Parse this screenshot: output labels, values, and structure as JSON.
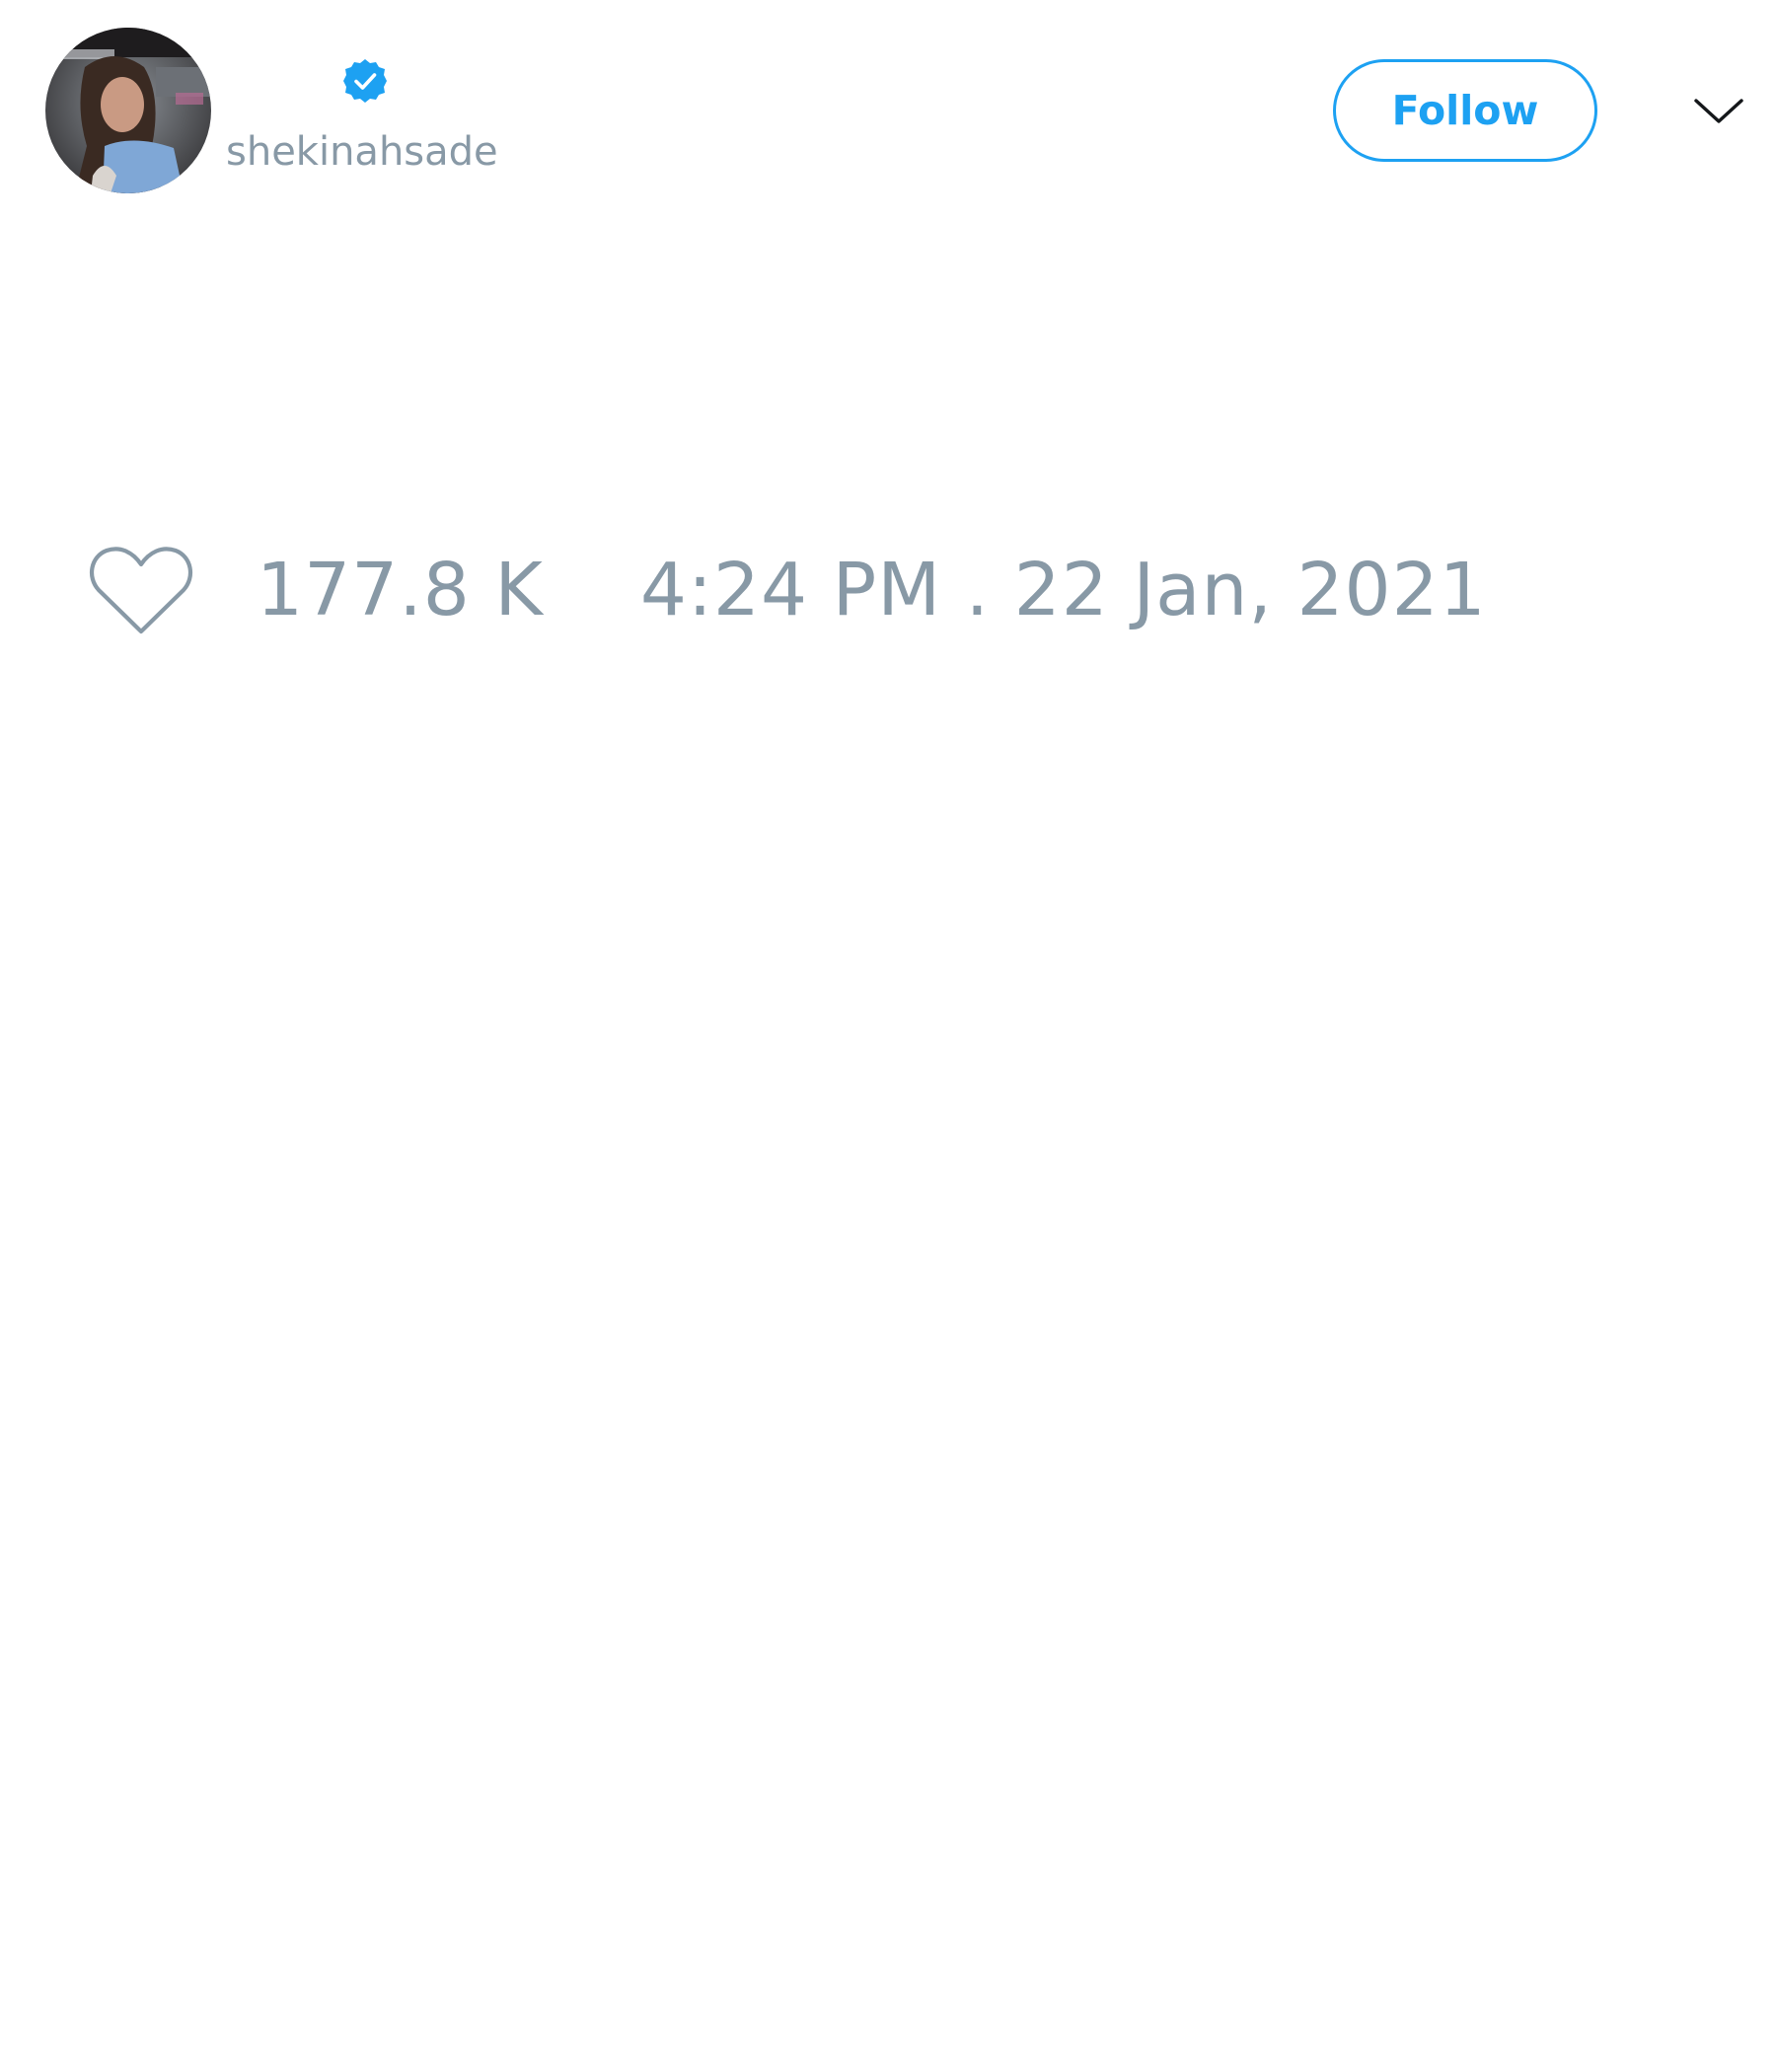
{
  "tweet": {
    "author": {
      "display_name": "",
      "handle": "shekinahsade",
      "verified": true,
      "avatar_icon": "avatar-photo"
    },
    "actions": {
      "follow_label": "Follow",
      "menu_icon": "chevron-down-icon"
    },
    "meta": {
      "like_icon": "heart-outline-icon",
      "like_count": "177.8 K",
      "timestamp": "4:24 PM . 22 Jan, 2021"
    }
  },
  "colors": {
    "accent": "#1da1f2",
    "muted_text": "#8899a6",
    "background": "#ffffff"
  }
}
